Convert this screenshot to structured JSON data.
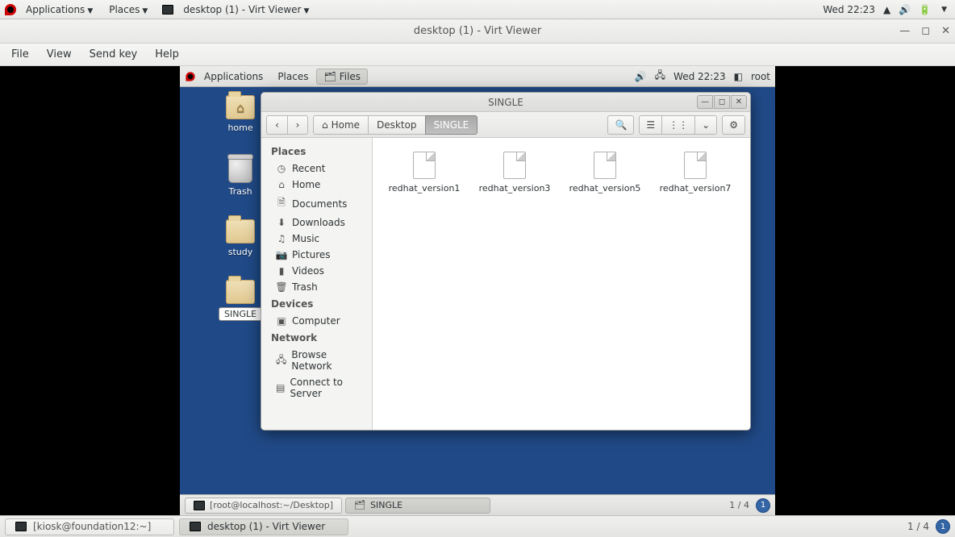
{
  "host": {
    "topbar": {
      "applications": "Applications",
      "places": "Places",
      "app_title": "desktop (1) - Virt Viewer",
      "clock": "Wed 22:23"
    },
    "taskbar": {
      "task1": "[kiosk@foundation12:~]",
      "task2": "desktop (1) - Virt Viewer",
      "ws_label": "1 / 4",
      "ws_current": "1"
    }
  },
  "vv": {
    "title": "desktop (1) - Virt Viewer",
    "menu": {
      "file": "File",
      "view": "View",
      "sendkey": "Send key",
      "help": "Help"
    }
  },
  "guest": {
    "panel": {
      "applications": "Applications",
      "places": "Places",
      "files": "Files",
      "clock": "Wed 22:23",
      "user": "root"
    },
    "desktop": {
      "home": "home",
      "trash": "Trash",
      "study": "study",
      "single": "SINGLE"
    },
    "taskbar": {
      "task1": "[root@localhost:~/Desktop]",
      "task2": "SINGLE",
      "ws_label": "1 / 4",
      "ws_current": "1"
    }
  },
  "nautilus": {
    "title": "SINGLE",
    "path": {
      "home": "Home",
      "desktop": "Desktop",
      "single": "SINGLE"
    },
    "sidebar": {
      "places_hdr": "Places",
      "recent": "Recent",
      "home": "Home",
      "documents": "Documents",
      "downloads": "Downloads",
      "music": "Music",
      "pictures": "Pictures",
      "videos": "Videos",
      "trash": "Trash",
      "devices_hdr": "Devices",
      "computer": "Computer",
      "network_hdr": "Network",
      "browse": "Browse Network",
      "connect": "Connect to Server"
    },
    "files": {
      "f0": "redhat_version1",
      "f1": "redhat_version3",
      "f2": "redhat_version5",
      "f3": "redhat_version7"
    }
  }
}
